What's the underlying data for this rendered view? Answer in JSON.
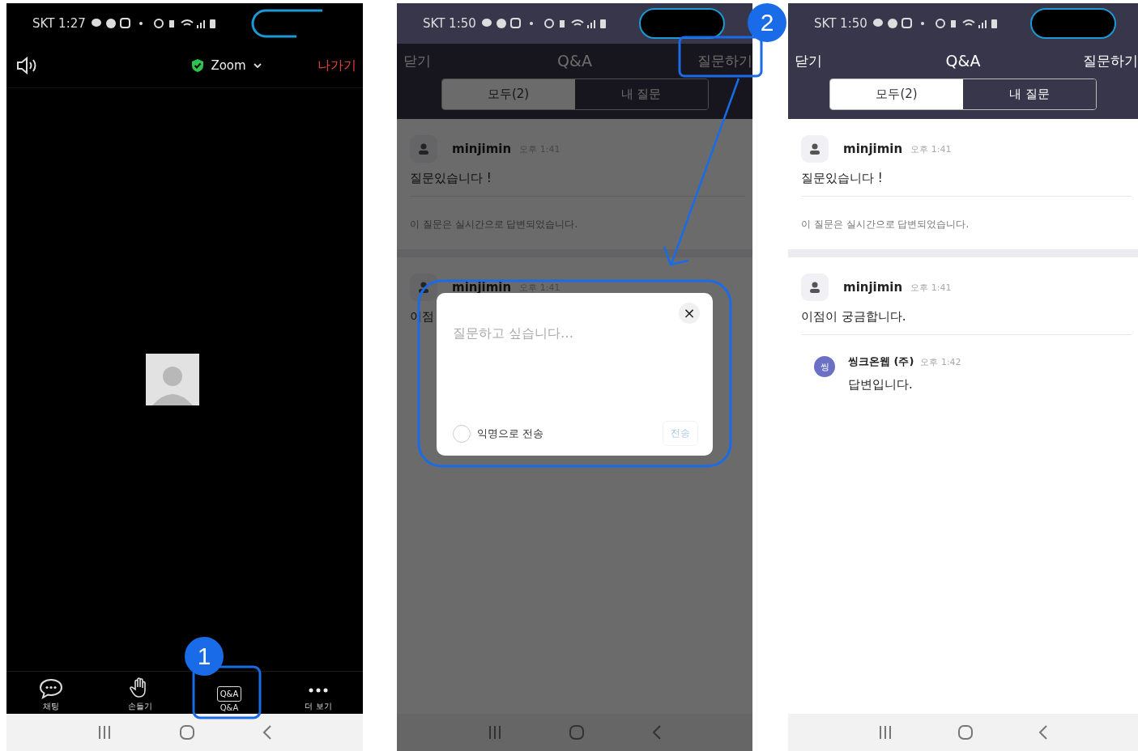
{
  "panels": [
    {
      "kind": "meeting",
      "status": "SKT 1:27",
      "header": {
        "title": "Zoom",
        "leave": "나가기"
      },
      "toolbar": [
        {
          "label": "채팅"
        },
        {
          "label": "손들기"
        },
        {
          "label": "Q&A",
          "icon_text": "Q&A"
        },
        {
          "label": "더 보기"
        }
      ]
    },
    {
      "kind": "qa",
      "dimmed": true,
      "status": "SKT 1:50",
      "header": {
        "close": "닫기",
        "title": "Q&A",
        "action": "질문하기"
      },
      "tabs": [
        {
          "label": "모두(2)",
          "selected": true
        },
        {
          "label": "내 질문",
          "selected": false
        }
      ],
      "posts": [
        {
          "author": "minjimin",
          "time": "오후 1:41",
          "text": "질문있습니다 !",
          "note": "이 질문은 실시간으로 답변되었습니다."
        },
        {
          "author": "minjimin",
          "time": "오후 1:41",
          "text": "이점"
        }
      ],
      "dialog": {
        "placeholder": "질문하고 싶습니다…",
        "close": "×",
        "anonymous": {
          "label": "익명으로 전송",
          "checked": false
        },
        "send": {
          "label": "전송",
          "disabled": true
        }
      }
    },
    {
      "kind": "qa",
      "dimmed": false,
      "status": "SKT 1:50",
      "header": {
        "close": "닫기",
        "title": "Q&A",
        "action": "질문하기"
      },
      "tabs": [
        {
          "label": "모두(2)",
          "selected": true
        },
        {
          "label": "내 질문",
          "selected": false
        }
      ],
      "posts": [
        {
          "author": "minjimin",
          "time": "오후 1:41",
          "text": "질문있습니다 !",
          "note": "이 질문은 실시간으로 답변되었습니다."
        },
        {
          "author": "minjimin",
          "time": "오후 1:41",
          "text": "이점이 궁금합니다.",
          "replies": [
            {
              "initial": "씽",
              "author": "씽크온웹 (주)",
              "time": "오후 1:42",
              "text": "답변입니다."
            }
          ]
        }
      ]
    }
  ],
  "annotations": [
    {
      "number": "1"
    },
    {
      "number": "2"
    }
  ]
}
